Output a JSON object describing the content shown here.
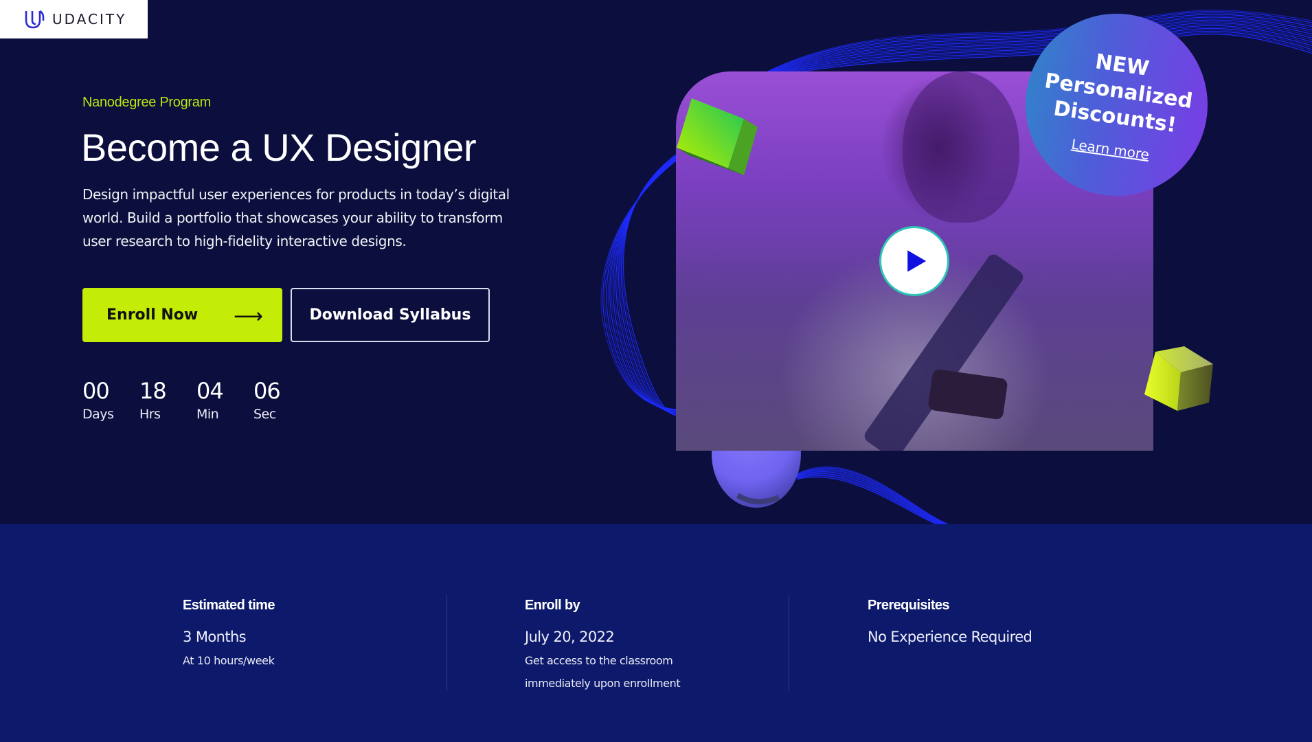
{
  "brand": {
    "name": "UDACITY",
    "logo_icon": "udacity-u-logo-icon"
  },
  "colors": {
    "hero_bg": "#0c0f3d",
    "stats_bg": "#0d1a6c",
    "accent_lime": "#c3ec06",
    "eyebrow": "#b9e80d",
    "play_ring": "#2ec4b6",
    "play_icon": "#1010e0",
    "wave": "#1f2bff"
  },
  "hero": {
    "eyebrow": "Nanodegree Program",
    "title": "Become a UX Designer",
    "description": "Design impactful user experiences for products in today’s digital world. Build a portfolio that showcases your ability to transform user research to high-fidelity interactive designs.",
    "enroll_button": {
      "label": "Enroll Now",
      "icon": "arrow-right-icon",
      "arrow": "⟶"
    },
    "syllabus_button": {
      "label": "Download Syllabus"
    },
    "countdown": [
      {
        "value": "00",
        "label": "Days"
      },
      {
        "value": "18",
        "label": "Hrs"
      },
      {
        "value": "04",
        "label": "Min"
      },
      {
        "value": "06",
        "label": "Sec"
      }
    ]
  },
  "media": {
    "play_icon": "play-icon",
    "badge": {
      "line1": "NEW",
      "line2": "Personalized",
      "line3": "Discounts!",
      "link": "Learn more"
    }
  },
  "stats": [
    {
      "label": "Estimated time",
      "value": "3 Months",
      "sub": [
        "At 10 hours/week"
      ]
    },
    {
      "label": "Enroll by",
      "value": "July 20, 2022",
      "sub": [
        "Get access to the classroom",
        "immediately upon enrollment"
      ]
    },
    {
      "label": "Prerequisites",
      "value": "No Experience Required",
      "sub": []
    }
  ]
}
